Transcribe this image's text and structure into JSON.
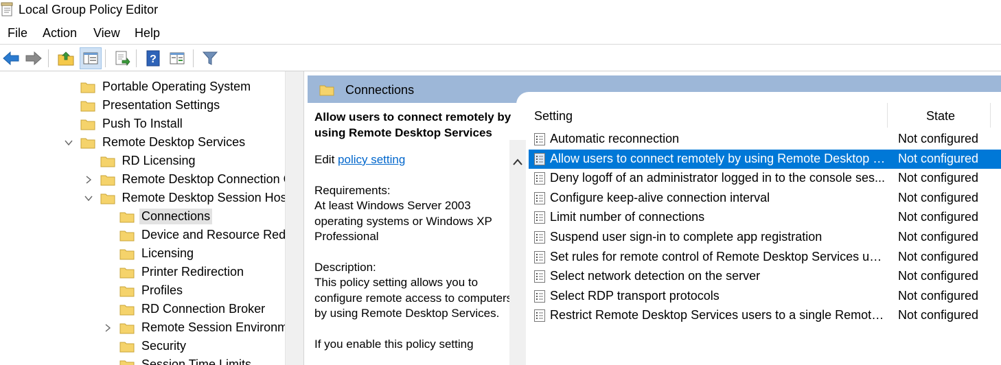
{
  "window": {
    "title": "Local Group Policy Editor"
  },
  "menu": {
    "file": "File",
    "action": "Action",
    "view": "View",
    "help": "Help"
  },
  "toolbar": {
    "buttons": [
      "back-arrow-icon",
      "forward-arrow-icon",
      "up-folder-icon",
      "show-hide-tree-icon",
      "export-list-icon",
      "help-icon",
      "extended-view-icon",
      "filter-icon"
    ],
    "active": "show-hide-tree-icon"
  },
  "tree": {
    "items": [
      {
        "label": "Portable Operating System"
      },
      {
        "label": "Presentation Settings"
      },
      {
        "label": "Push To Install"
      },
      {
        "label": "Remote Desktop Services"
      },
      {
        "label": "RD Licensing"
      },
      {
        "label": "Remote Desktop Connection C"
      },
      {
        "label": "Remote Desktop Session Host"
      },
      {
        "label": "Connections"
      },
      {
        "label": "Device and Resource Redire"
      },
      {
        "label": "Licensing"
      },
      {
        "label": "Printer Redirection"
      },
      {
        "label": "Profiles"
      },
      {
        "label": "RD Connection Broker"
      },
      {
        "label": "Remote Session Environme"
      },
      {
        "label": "Security"
      },
      {
        "label": "Session Time Limits"
      }
    ],
    "selected": "Connections"
  },
  "section": {
    "title": "Connections"
  },
  "description": {
    "heading": "Allow users to connect remotely by using Remote Desktop Services",
    "edit_prefix": "Edit",
    "edit_link": "policy setting",
    "requirements_label": "Requirements:",
    "requirements_text": "At least Windows Server 2003 operating systems or Windows XP Professional",
    "description_label": "Description:",
    "description_text": "This policy setting allows you to configure remote access to computers by using Remote Desktop Services.",
    "next_text": "If you enable this policy setting"
  },
  "list": {
    "col_setting": "Setting",
    "col_state": "State",
    "rows": [
      {
        "setting": "Automatic reconnection",
        "state": "Not configured"
      },
      {
        "setting": "Allow users to connect remotely by using Remote Desktop Se...",
        "state": "Not configured"
      },
      {
        "setting": "Deny logoff of an administrator logged in to the console ses...",
        "state": "Not configured"
      },
      {
        "setting": "Configure keep-alive connection interval",
        "state": "Not configured"
      },
      {
        "setting": "Limit number of connections",
        "state": "Not configured"
      },
      {
        "setting": "Suspend user sign-in to complete app registration",
        "state": "Not configured"
      },
      {
        "setting": "Set rules for remote control of Remote Desktop Services user ...",
        "state": "Not configured"
      },
      {
        "setting": "Select network detection on the server",
        "state": "Not configured"
      },
      {
        "setting": "Select RDP transport protocols",
        "state": "Not configured"
      },
      {
        "setting": "Restrict Remote Desktop Services users to a single Remote De...",
        "state": "Not configured"
      }
    ],
    "selected_index": 1
  },
  "colors": {
    "selection": "#0078d7",
    "header_band": "#9db7d8",
    "link": "#0066cc",
    "folder": "#f5d36b"
  }
}
